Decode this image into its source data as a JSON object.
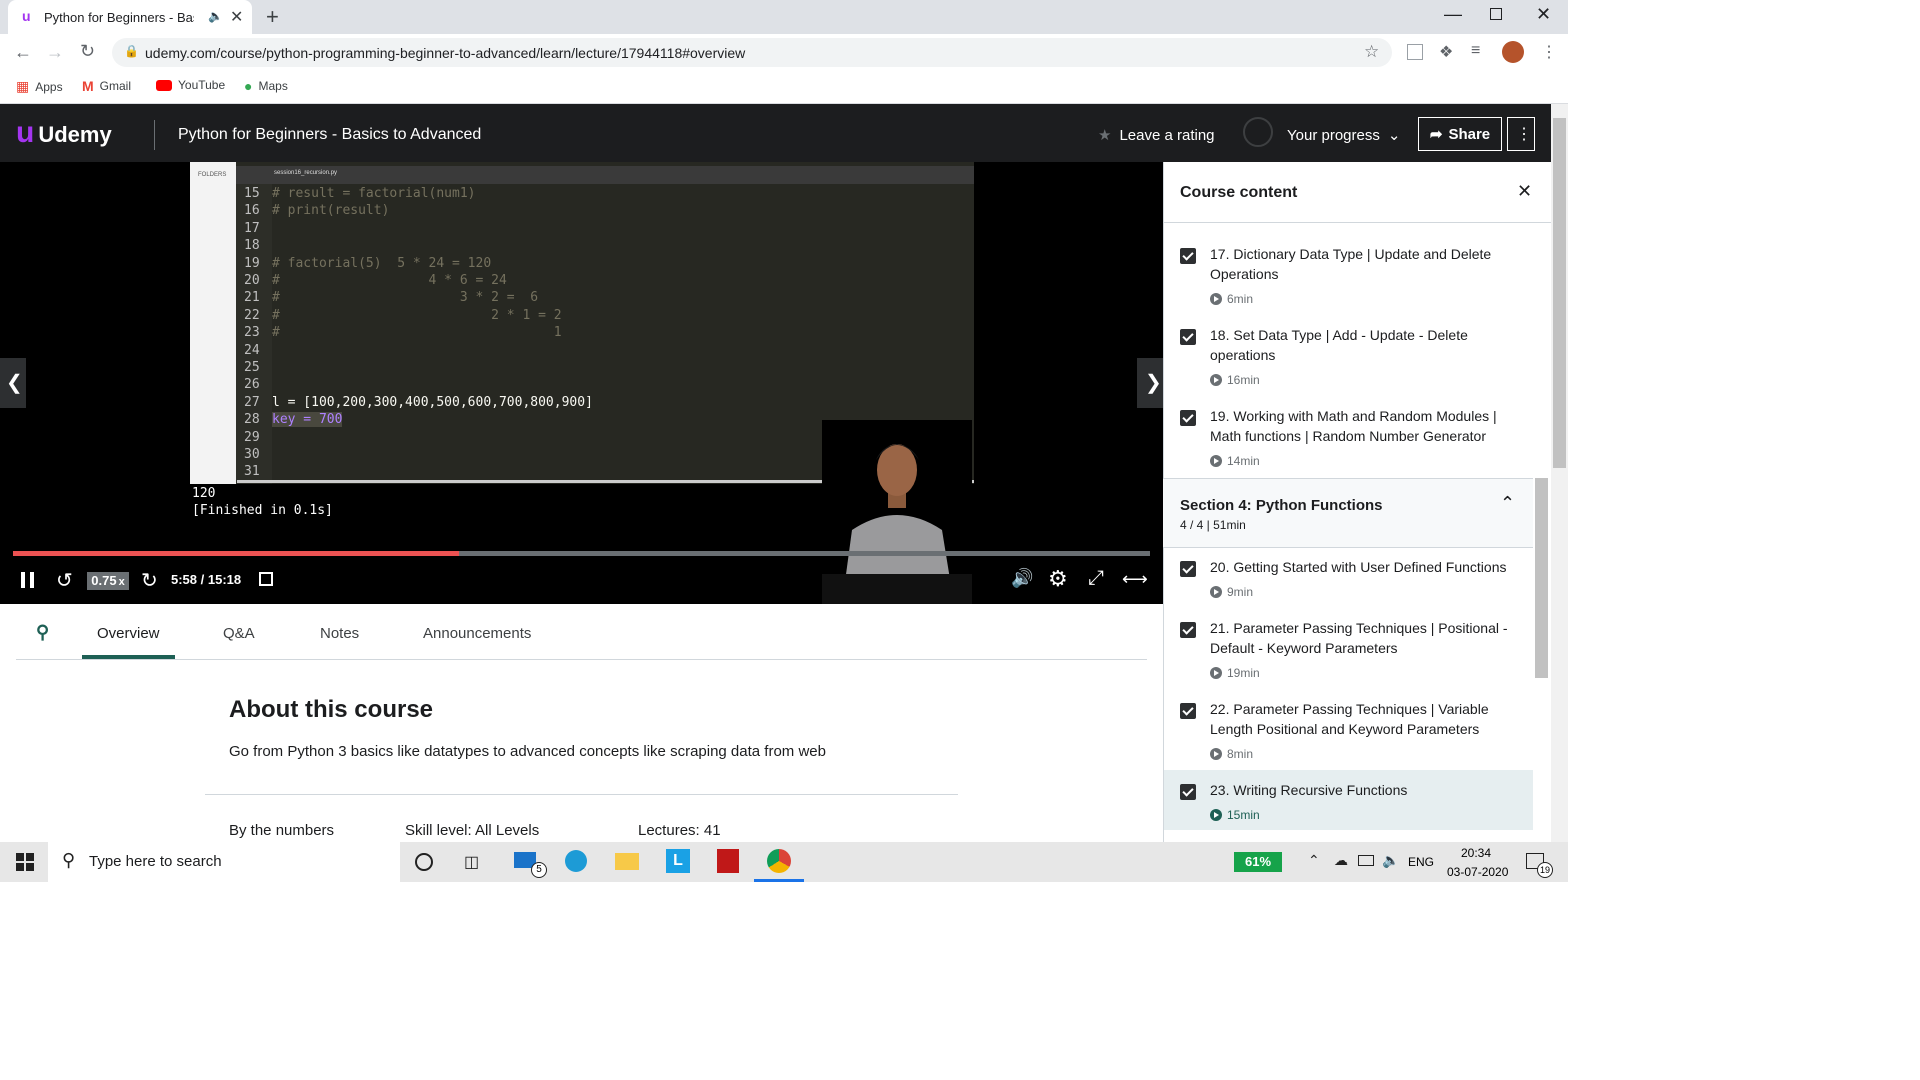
{
  "browser": {
    "tab_title": "Python for Beginners - Basics",
    "url": "udemy.com/course/python-programming-beginner-to-advanced/learn/lecture/17944118#overview",
    "bookmarks": [
      "Apps",
      "Gmail",
      "YouTube",
      "Maps"
    ]
  },
  "header": {
    "brand": "Udemy",
    "course_title": "Python for Beginners - Basics to Advanced",
    "rating_label": "Leave a rating",
    "progress_label": "Your progress",
    "share_label": "Share"
  },
  "editor": {
    "folders_label": "FOLDERS",
    "file_tab": "session16_recursion.py",
    "lines": [
      {
        "n": "15",
        "code": "# result = factorial(num1)"
      },
      {
        "n": "16",
        "code": "# print(result)"
      },
      {
        "n": "17",
        "code": ""
      },
      {
        "n": "18",
        "code": ""
      },
      {
        "n": "19",
        "code": "# factorial(5)  5 * 24 = 120"
      },
      {
        "n": "20",
        "code": "#                   4 * 6 = 24"
      },
      {
        "n": "21",
        "code": "#                       3 * 2 =  6"
      },
      {
        "n": "22",
        "code": "#                           2 * 1 = 2"
      },
      {
        "n": "23",
        "code": "#                                   1"
      },
      {
        "n": "24",
        "code": ""
      },
      {
        "n": "25",
        "code": ""
      },
      {
        "n": "26",
        "code": ""
      },
      {
        "n": "27",
        "code": "l = [100,200,300,400,500,600,700,800,900]"
      },
      {
        "n": "28",
        "code": "key = 700"
      },
      {
        "n": "29",
        "code": ""
      },
      {
        "n": "30",
        "code": ""
      },
      {
        "n": "31",
        "code": ""
      }
    ],
    "console": [
      "120",
      "[Finished in 0.1s]"
    ]
  },
  "player": {
    "speed": "0.75",
    "speed_suffix": "x",
    "time": "5:58 / 15:18",
    "progress": 0.392
  },
  "tabs": [
    "Overview",
    "Q&A",
    "Notes",
    "Announcements"
  ],
  "overview": {
    "heading": "About this course",
    "description": "Go from Python 3 basics like datatypes to advanced concepts like scraping data from web",
    "stats": [
      "By the numbers",
      "Skill level: All Levels",
      "Lectures: 41"
    ]
  },
  "sidebar": {
    "title": "Course content",
    "lectures_before": [
      {
        "title": "17. Dictionary Data Type | Update and Delete Operations",
        "duration": "6min"
      },
      {
        "title": "18. Set Data Type | Add - Update - Delete operations",
        "duration": "16min"
      },
      {
        "title": "19. Working with Math and Random Modules | Math functions | Random Number Generator",
        "duration": "14min"
      }
    ],
    "section": {
      "title": "Section 4: Python Functions",
      "meta": "4 / 4 | 51min"
    },
    "lectures_after": [
      {
        "title": "20. Getting Started with User Defined Functions",
        "duration": "9min"
      },
      {
        "title": "21. Parameter Passing Techniques | Positional - Default - Keyword Parameters",
        "duration": "19min"
      },
      {
        "title": "22. Parameter Passing Techniques | Variable Length Positional and Keyword Parameters",
        "duration": "8min"
      },
      {
        "title": "23. Writing Recursive Functions",
        "duration": "15min"
      }
    ]
  },
  "taskbar": {
    "search_placeholder": "Type here to search",
    "battery": "61%",
    "lang": "ENG",
    "time": "20:34",
    "date": "03-07-2020",
    "notifications": "19",
    "mail_badge": "5"
  }
}
